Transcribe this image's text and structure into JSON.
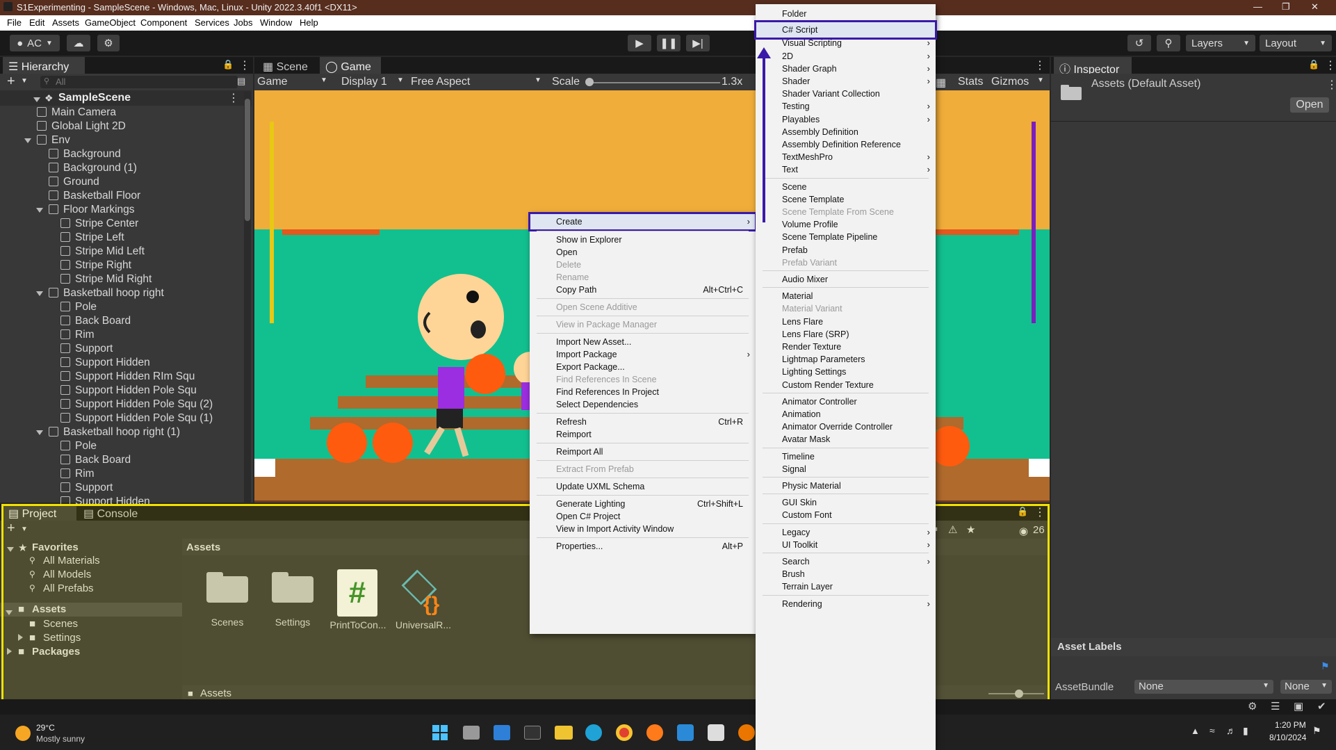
{
  "window": {
    "title": "S1Experimenting - SampleScene - Windows, Mac, Linux - Unity 2022.3.40f1 <DX11>"
  },
  "menu": [
    "File",
    "Edit",
    "Assets",
    "GameObject",
    "Component",
    "Services",
    "Jobs",
    "Window",
    "Help"
  ],
  "toolbar": {
    "account": "AC",
    "layers": "Layers",
    "layout": "Layout"
  },
  "hierarchy": {
    "tab": "Hierarchy",
    "search_placeholder": "All",
    "scene": "SampleScene",
    "items": [
      {
        "label": "Main Camera",
        "depth": 1
      },
      {
        "label": "Global Light 2D",
        "depth": 1
      },
      {
        "label": "Env",
        "depth": 1,
        "expanded": true
      },
      {
        "label": "Background",
        "depth": 2
      },
      {
        "label": "Background (1)",
        "depth": 2
      },
      {
        "label": "Ground",
        "depth": 2
      },
      {
        "label": "Basketball Floor",
        "depth": 2
      },
      {
        "label": "Floor Markings",
        "depth": 2,
        "expanded": true
      },
      {
        "label": "Stripe Center",
        "depth": 3
      },
      {
        "label": "Stripe Left",
        "depth": 3
      },
      {
        "label": "Stripe Mid Left",
        "depth": 3
      },
      {
        "label": "Stripe Right",
        "depth": 3
      },
      {
        "label": "Stripe Mid Right",
        "depth": 3
      },
      {
        "label": "Basketball hoop right",
        "depth": 2,
        "expanded": true
      },
      {
        "label": "Pole",
        "depth": 3
      },
      {
        "label": "Back Board",
        "depth": 3
      },
      {
        "label": "Rim",
        "depth": 3
      },
      {
        "label": "Support",
        "depth": 3
      },
      {
        "label": "Support Hidden",
        "depth": 3
      },
      {
        "label": "Support Hidden RIm Squ",
        "depth": 3
      },
      {
        "label": "Support Hidden Pole Squ",
        "depth": 3
      },
      {
        "label": "Support Hidden Pole Squ (2)",
        "depth": 3
      },
      {
        "label": "Support Hidden Pole Squ (1)",
        "depth": 3
      },
      {
        "label": "Basketball hoop right (1)",
        "depth": 2,
        "expanded": true
      },
      {
        "label": "Pole",
        "depth": 3
      },
      {
        "label": "Back Board",
        "depth": 3
      },
      {
        "label": "Rim",
        "depth": 3
      },
      {
        "label": "Support",
        "depth": 3
      },
      {
        "label": "Support Hidden",
        "depth": 3
      }
    ]
  },
  "game_view": {
    "tabs": [
      "Scene",
      "Game"
    ],
    "display_mode": "Game",
    "display": "Display 1",
    "aspect": "Free Aspect",
    "scale_label": "Scale",
    "scale_value": "1.3x",
    "stats": "Stats",
    "gizmos": "Gizmos"
  },
  "inspector": {
    "tab": "Inspector",
    "title": "Assets (Default Asset)",
    "open_button": "Open",
    "asset_labels": "Asset Labels",
    "asset_bundle_label": "AssetBundle",
    "asset_bundle_value": "None",
    "asset_bundle_variant": "None"
  },
  "project": {
    "tabs": [
      "Project",
      "Console"
    ],
    "favorites": "Favorites",
    "favorite_items": [
      "All Materials",
      "All Models",
      "All Prefabs"
    ],
    "assets_root": "Assets",
    "asset_children": [
      "Scenes",
      "Settings"
    ],
    "packages": "Packages",
    "breadcrumb": "Assets",
    "footer_path": "Assets",
    "hidden_count": "26",
    "files": [
      {
        "label": "Scenes",
        "type": "folder"
      },
      {
        "label": "Settings",
        "type": "folder"
      },
      {
        "label": "PrintToCon...",
        "type": "script"
      },
      {
        "label": "UniversalR...",
        "type": "asset"
      }
    ]
  },
  "context_menu": {
    "items": [
      {
        "label": "Create",
        "submenu": true,
        "highlight": true
      },
      {
        "sep": true
      },
      {
        "label": "Show in Explorer"
      },
      {
        "label": "Open"
      },
      {
        "label": "Delete",
        "disabled": true
      },
      {
        "label": "Rename",
        "disabled": true
      },
      {
        "label": "Copy Path",
        "shortcut": "Alt+Ctrl+C"
      },
      {
        "sep": true
      },
      {
        "label": "Open Scene Additive",
        "disabled": true
      },
      {
        "sep": true
      },
      {
        "label": "View in Package Manager",
        "disabled": true
      },
      {
        "sep": true
      },
      {
        "label": "Import New Asset..."
      },
      {
        "label": "Import Package",
        "submenu": true
      },
      {
        "label": "Export Package..."
      },
      {
        "label": "Find References In Scene",
        "disabled": true
      },
      {
        "label": "Find References In Project"
      },
      {
        "label": "Select Dependencies"
      },
      {
        "sep": true
      },
      {
        "label": "Refresh",
        "shortcut": "Ctrl+R"
      },
      {
        "label": "Reimport"
      },
      {
        "sep": true
      },
      {
        "label": "Reimport All"
      },
      {
        "sep": true
      },
      {
        "label": "Extract From Prefab",
        "disabled": true
      },
      {
        "sep": true
      },
      {
        "label": "Update UXML Schema"
      },
      {
        "sep": true
      },
      {
        "label": "Generate Lighting",
        "shortcut": "Ctrl+Shift+L"
      },
      {
        "label": "Open C# Project"
      },
      {
        "label": "View in Import Activity Window"
      },
      {
        "sep": true
      },
      {
        "label": "Properties...",
        "shortcut": "Alt+P"
      }
    ]
  },
  "create_submenu": {
    "items": [
      {
        "label": "Folder"
      },
      {
        "sep": true
      },
      {
        "label": "C# Script",
        "highlight": true
      },
      {
        "label": "Visual Scripting",
        "submenu": true
      },
      {
        "label": "2D",
        "submenu": true
      },
      {
        "label": "Shader Graph",
        "submenu": true
      },
      {
        "label": "Shader",
        "submenu": true
      },
      {
        "label": "Shader Variant Collection"
      },
      {
        "label": "Testing",
        "submenu": true
      },
      {
        "label": "Playables",
        "submenu": true
      },
      {
        "label": "Assembly Definition"
      },
      {
        "label": "Assembly Definition Reference"
      },
      {
        "label": "TextMeshPro",
        "submenu": true
      },
      {
        "label": "Text",
        "submenu": true
      },
      {
        "sep": true
      },
      {
        "label": "Scene"
      },
      {
        "label": "Scene Template"
      },
      {
        "label": "Scene Template From Scene",
        "disabled": true
      },
      {
        "label": "Volume Profile"
      },
      {
        "label": "Scene Template Pipeline"
      },
      {
        "label": "Prefab"
      },
      {
        "label": "Prefab Variant",
        "disabled": true
      },
      {
        "sep": true
      },
      {
        "label": "Audio Mixer"
      },
      {
        "sep": true
      },
      {
        "label": "Material"
      },
      {
        "label": "Material Variant",
        "disabled": true
      },
      {
        "label": "Lens Flare"
      },
      {
        "label": "Lens Flare (SRP)"
      },
      {
        "label": "Render Texture"
      },
      {
        "label": "Lightmap Parameters"
      },
      {
        "label": "Lighting Settings"
      },
      {
        "label": "Custom Render Texture"
      },
      {
        "sep": true
      },
      {
        "label": "Animator Controller"
      },
      {
        "label": "Animation"
      },
      {
        "label": "Animator Override Controller"
      },
      {
        "label": "Avatar Mask"
      },
      {
        "sep": true
      },
      {
        "label": "Timeline"
      },
      {
        "label": "Signal"
      },
      {
        "sep": true
      },
      {
        "label": "Physic Material"
      },
      {
        "sep": true
      },
      {
        "label": "GUI Skin"
      },
      {
        "label": "Custom Font"
      },
      {
        "sep": true
      },
      {
        "label": "Legacy",
        "submenu": true
      },
      {
        "label": "UI Toolkit",
        "submenu": true
      },
      {
        "sep": true
      },
      {
        "label": "Search",
        "submenu": true
      },
      {
        "label": "Brush"
      },
      {
        "label": "Terrain Layer"
      },
      {
        "sep": true
      },
      {
        "label": "Rendering",
        "submenu": true
      }
    ]
  },
  "taskbar": {
    "weather_temp": "29°C",
    "weather_desc": "Mostly sunny",
    "time": "1:20 PM",
    "date": "8/10/2024"
  },
  "colors": {
    "highlight_box": "#3a1aa8",
    "yellow_box": "#f2e200",
    "sky": "#f0ad3a",
    "court": "#12c08f",
    "ball": "#ff5b0f"
  }
}
